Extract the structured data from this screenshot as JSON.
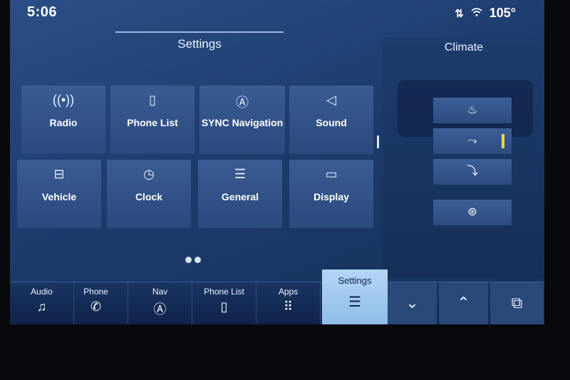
{
  "status": {
    "time": "5:06",
    "temperature": "105°",
    "icons": [
      "data-transfer-icon",
      "wifi-icon"
    ]
  },
  "settings": {
    "title": "Settings",
    "tiles": [
      {
        "label": "Radio",
        "icon": "radio-antenna-icon"
      },
      {
        "label": "Phone List",
        "icon": "phone-list-icon"
      },
      {
        "label": "SYNC Navigation",
        "icon": "navigation-icon"
      },
      {
        "label": "Sound",
        "icon": "speaker-icon"
      },
      {
        "label": "Vehicle",
        "icon": "vehicle-icon"
      },
      {
        "label": "Clock",
        "icon": "clock-icon"
      },
      {
        "label": "General",
        "icon": "sliders-icon"
      },
      {
        "label": "Display",
        "icon": "display-icon"
      }
    ],
    "page_count": 2
  },
  "climate": {
    "title": "Climate",
    "buttons": [
      {
        "icon": "defrost-icon"
      },
      {
        "icon": "face-vent-icon",
        "active": true
      },
      {
        "icon": "seat-airflow-icon"
      },
      {
        "icon": "heated-steering-icon"
      }
    ],
    "active_color": "#f2d64a"
  },
  "nav": {
    "items": [
      {
        "label": "Audio",
        "icon": "music-note-icon"
      },
      {
        "label": "Phone",
        "icon": "phone-icon"
      },
      {
        "label": "Nav",
        "icon": "navigation-icon"
      },
      {
        "label": "Phone List",
        "icon": "phone-list-icon"
      },
      {
        "label": "Apps",
        "icon": "apps-grid-icon"
      },
      {
        "label": "Settings",
        "icon": "sliders-icon",
        "active": true
      }
    ],
    "buttons": [
      "chevron-down-icon",
      "chevron-up-icon",
      "multitask-icon"
    ]
  }
}
